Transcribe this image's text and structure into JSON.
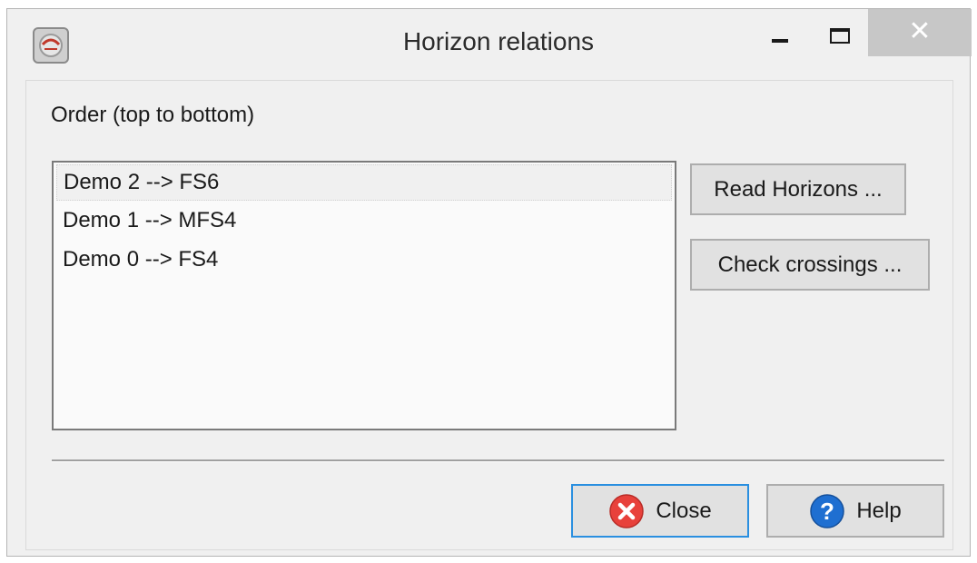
{
  "window": {
    "title": "Horizon relations",
    "close_glyph": "✕",
    "app_icon": "app-logo-icon"
  },
  "main": {
    "order_label": "Order (top to bottom)",
    "list_items": [
      {
        "label": "Demo 2 --> FS6",
        "selected": true
      },
      {
        "label": "Demo 1 --> MFS4",
        "selected": false
      },
      {
        "label": "Demo 0 --> FS4",
        "selected": false
      }
    ],
    "read_horizons_label": "Read Horizons ...",
    "check_crossings_label": "Check crossings ..."
  },
  "footer": {
    "close_label": "Close",
    "help_label": "Help",
    "close_icon": "error-circle-icon",
    "help_icon": "question-circle-icon"
  },
  "colors": {
    "close_icon": "#e8413b",
    "help_icon": "#1f6fd1",
    "focus_border": "#2a8fe0"
  }
}
